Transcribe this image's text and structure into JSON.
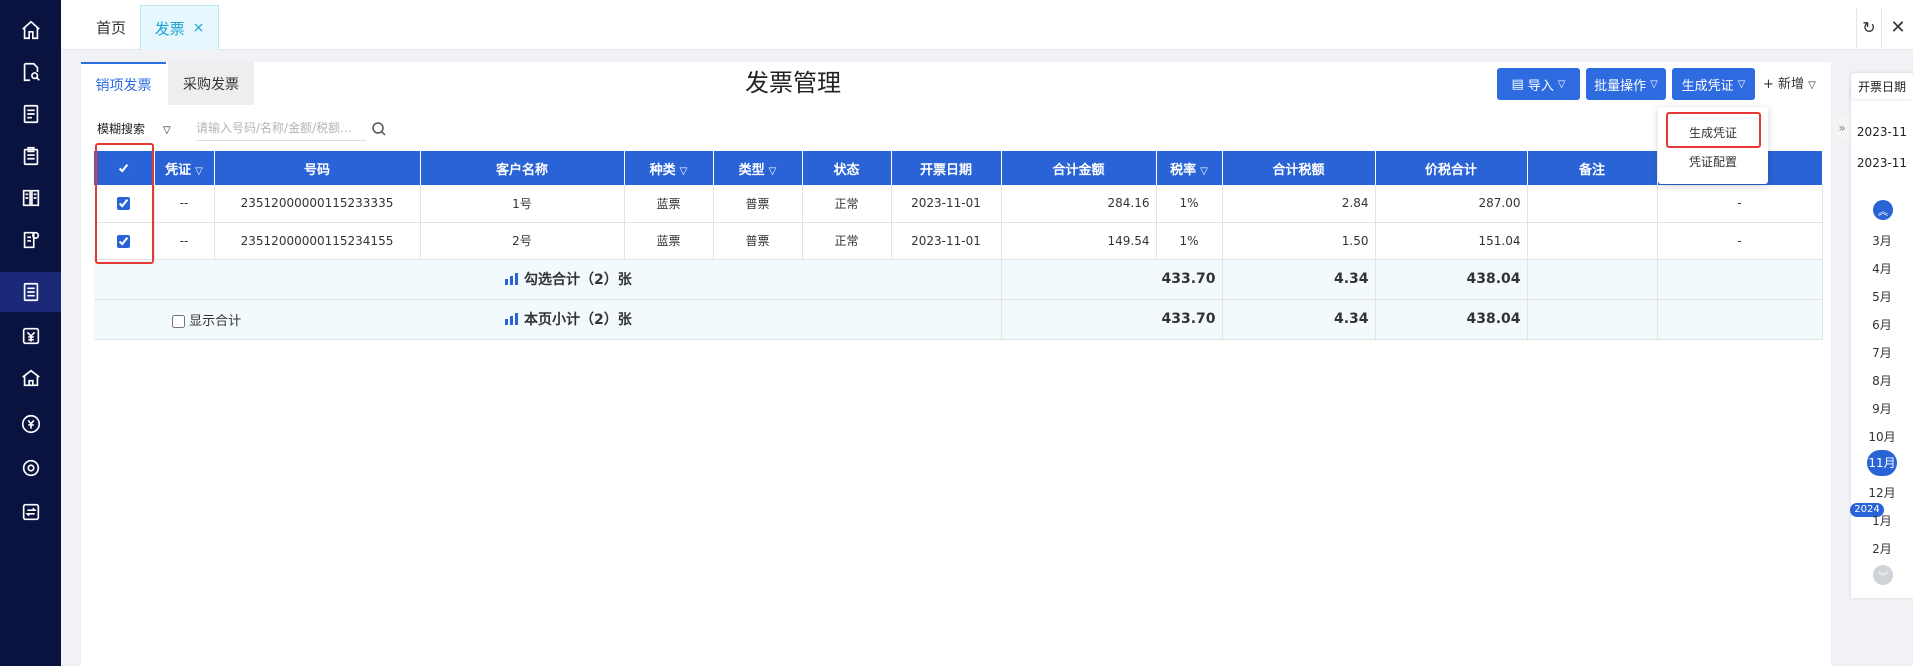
{
  "topbar": {
    "home_tab": "首页",
    "invoice_tab": "发票",
    "close_glyph": "×"
  },
  "sidebar": {
    "icons": [
      "home-icon",
      "search-doc-icon",
      "list-icon",
      "clipboard-icon",
      "ledger-icon",
      "edit-doc-icon",
      "invoice-icon",
      "yuan-icon",
      "building-icon",
      "yuan-circle-icon",
      "gear-icon",
      "transfer-icon"
    ],
    "active_index": 6
  },
  "page": {
    "title": "发票管理",
    "tabs": {
      "sales": "销项发票",
      "purchase": "采购发票"
    }
  },
  "toolbar": {
    "import": "导入",
    "batch": "批量操作",
    "generate": "生成凭证",
    "add": "+ 新增"
  },
  "dropdown": {
    "generate_voucher": "生成凭证",
    "voucher_config": "凭证配置"
  },
  "search": {
    "mode": "模糊搜索",
    "placeholder": "请输入号码/名称/金额/税额..."
  },
  "table": {
    "headers": [
      "凭证",
      "号码",
      "客户名称",
      "种类",
      "类型",
      "状态",
      "开票日期",
      "合计金额",
      "税率",
      "合计税额",
      "价税合计",
      "备注"
    ],
    "rows": [
      {
        "voucher": "--",
        "number": "23512000000115233335",
        "customer": "1号",
        "kind": "蓝票",
        "type": "普票",
        "status": "正常",
        "date": "2023-11-01",
        "amount": "284.16",
        "tax_rate": "1%",
        "tax": "2.84",
        "total": "287.00",
        "remark": "",
        "extra": "-"
      },
      {
        "voucher": "--",
        "number": "23512000000115234155",
        "customer": "2号",
        "kind": "蓝票",
        "type": "普票",
        "status": "正常",
        "date": "2023-11-01",
        "amount": "149.54",
        "tax_rate": "1%",
        "tax": "1.50",
        "total": "151.04",
        "remark": "",
        "extra": "-"
      }
    ],
    "selected_summary": {
      "label": "勾选合计（2）张",
      "amount": "433.70",
      "tax": "4.34",
      "total": "438.04"
    },
    "page_summary": {
      "show_total_label": "显示合计",
      "label": "本页小计（2）张",
      "amount": "433.70",
      "tax": "4.34",
      "total": "438.04"
    }
  },
  "date_rail": {
    "header": "开票日期",
    "range_start": "2023-11",
    "range_end": "2023-11",
    "months": [
      "3月",
      "4月",
      "5月",
      "6月",
      "7月",
      "8月",
      "9月",
      "10月",
      "11月",
      "12月",
      "1月",
      "2月"
    ],
    "active_month": "11月",
    "year_badge": "2024"
  },
  "colors": {
    "accent": "#2a63d6",
    "rail": "#0a1340",
    "highlight": "#e53935"
  }
}
